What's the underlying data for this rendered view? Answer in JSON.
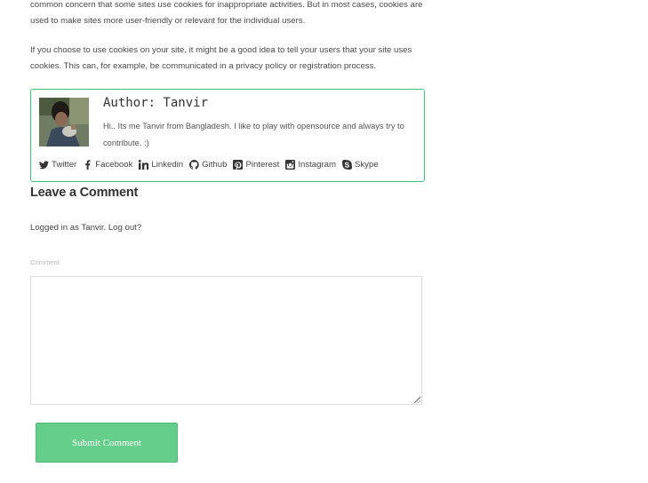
{
  "article": {
    "paragraph1": "common concern that some sites use cookies for inappropriate activities. But in most cases, cookies are used to make sites more user-friendly or relevant for the individual users.",
    "paragraph2": "If you choose to use cookies on your site, it might be a good idea to tell your users that your site uses cookies. This can, for example, be communicated in a privacy policy or registration process."
  },
  "author": {
    "title": "Author: Tanvir",
    "bio": "Hi.. Its me Tanvir from Bangladesh. I like to play with opensource and always try to contribute. :)",
    "social": [
      {
        "label": "Twitter",
        "icon": "twitter-icon"
      },
      {
        "label": "Facebook",
        "icon": "facebook-icon"
      },
      {
        "label": "Linkedin",
        "icon": "linkedin-icon"
      },
      {
        "label": "Github",
        "icon": "github-icon"
      },
      {
        "label": "Pinterest",
        "icon": "pinterest-icon"
      },
      {
        "label": "Instagram",
        "icon": "instagram-icon"
      },
      {
        "label": "Skype",
        "icon": "skype-icon"
      }
    ]
  },
  "comment": {
    "heading": "Leave a Comment",
    "logged_prefix": "Logged in as Tanvir.",
    "logout_label": "Log out?",
    "field_label": "Comment",
    "submit_label": "Submit Comment"
  },
  "colors": {
    "accent": "#3fc37a",
    "button": "#66ce8b"
  }
}
